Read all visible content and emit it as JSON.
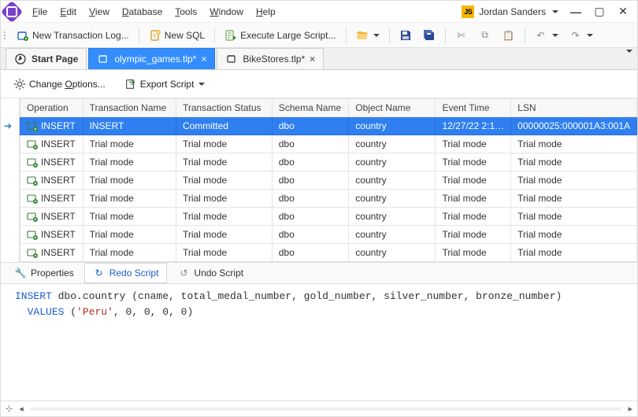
{
  "menu": {
    "items": [
      {
        "label": "File",
        "u": "F"
      },
      {
        "label": "Edit",
        "u": "E"
      },
      {
        "label": "View",
        "u": "V"
      },
      {
        "label": "Database",
        "u": "D"
      },
      {
        "label": "Tools",
        "u": "T"
      },
      {
        "label": "Window",
        "u": "W"
      },
      {
        "label": "Help",
        "u": "H"
      }
    ],
    "user_badge": "JS",
    "user_name": "Jordan Sanders"
  },
  "toolbar": {
    "new_trans": "New Transaction Log...",
    "new_sql": "New SQL",
    "exec_large": "Execute Large Script..."
  },
  "tabs": {
    "items": [
      {
        "label": "Start Page",
        "icon": "compass",
        "active": false,
        "bold": true,
        "closable": false
      },
      {
        "label": "olympic_games.tlp*",
        "icon": "transaction",
        "active": true,
        "closable": true
      },
      {
        "label": "BikeStores.tlp*",
        "icon": "transaction",
        "active": false,
        "closable": true
      }
    ]
  },
  "subtoolbar": {
    "change_options": "Change Options...",
    "export_script": "Export Script"
  },
  "grid": {
    "headers": [
      "Operation",
      "Transaction Name",
      "Transaction Status",
      "Schema Name",
      "Object Name",
      "Event Time",
      "LSN"
    ],
    "rows": [
      {
        "op": "INSERT",
        "name": "INSERT",
        "status": "Committed",
        "schema": "dbo",
        "object": "country",
        "time": "12/27/22 2:1…",
        "lsn": "00000025:000001A3:001A",
        "selected": true
      },
      {
        "op": "INSERT",
        "name": "Trial mode",
        "status": "Trial mode",
        "schema": "dbo",
        "object": "country",
        "time": "Trial mode",
        "lsn": "Trial mode"
      },
      {
        "op": "INSERT",
        "name": "Trial mode",
        "status": "Trial mode",
        "schema": "dbo",
        "object": "country",
        "time": "Trial mode",
        "lsn": "Trial mode"
      },
      {
        "op": "INSERT",
        "name": "Trial mode",
        "status": "Trial mode",
        "schema": "dbo",
        "object": "country",
        "time": "Trial mode",
        "lsn": "Trial mode"
      },
      {
        "op": "INSERT",
        "name": "Trial mode",
        "status": "Trial mode",
        "schema": "dbo",
        "object": "country",
        "time": "Trial mode",
        "lsn": "Trial mode"
      },
      {
        "op": "INSERT",
        "name": "Trial mode",
        "status": "Trial mode",
        "schema": "dbo",
        "object": "country",
        "time": "Trial mode",
        "lsn": "Trial mode"
      },
      {
        "op": "INSERT",
        "name": "Trial mode",
        "status": "Trial mode",
        "schema": "dbo",
        "object": "country",
        "time": "Trial mode",
        "lsn": "Trial mode"
      },
      {
        "op": "INSERT",
        "name": "Trial mode",
        "status": "Trial mode",
        "schema": "dbo",
        "object": "country",
        "time": "Trial mode",
        "lsn": "Trial mode"
      }
    ]
  },
  "bottom_tabs": {
    "properties": "Properties",
    "redo": "Redo Script",
    "undo": "Undo Script"
  },
  "sql": {
    "kw_insert": "INSERT",
    "target": "dbo.country (cname, total_medal_number, gold_number, silver_number, bronze_number)",
    "kw_values": "VALUES",
    "vals_prefix": "(",
    "str_literal": "'Peru'",
    "vals_suffix": ", 0, 0, 0, 0)"
  },
  "statusbar": {
    "split_icon": "⊹"
  }
}
